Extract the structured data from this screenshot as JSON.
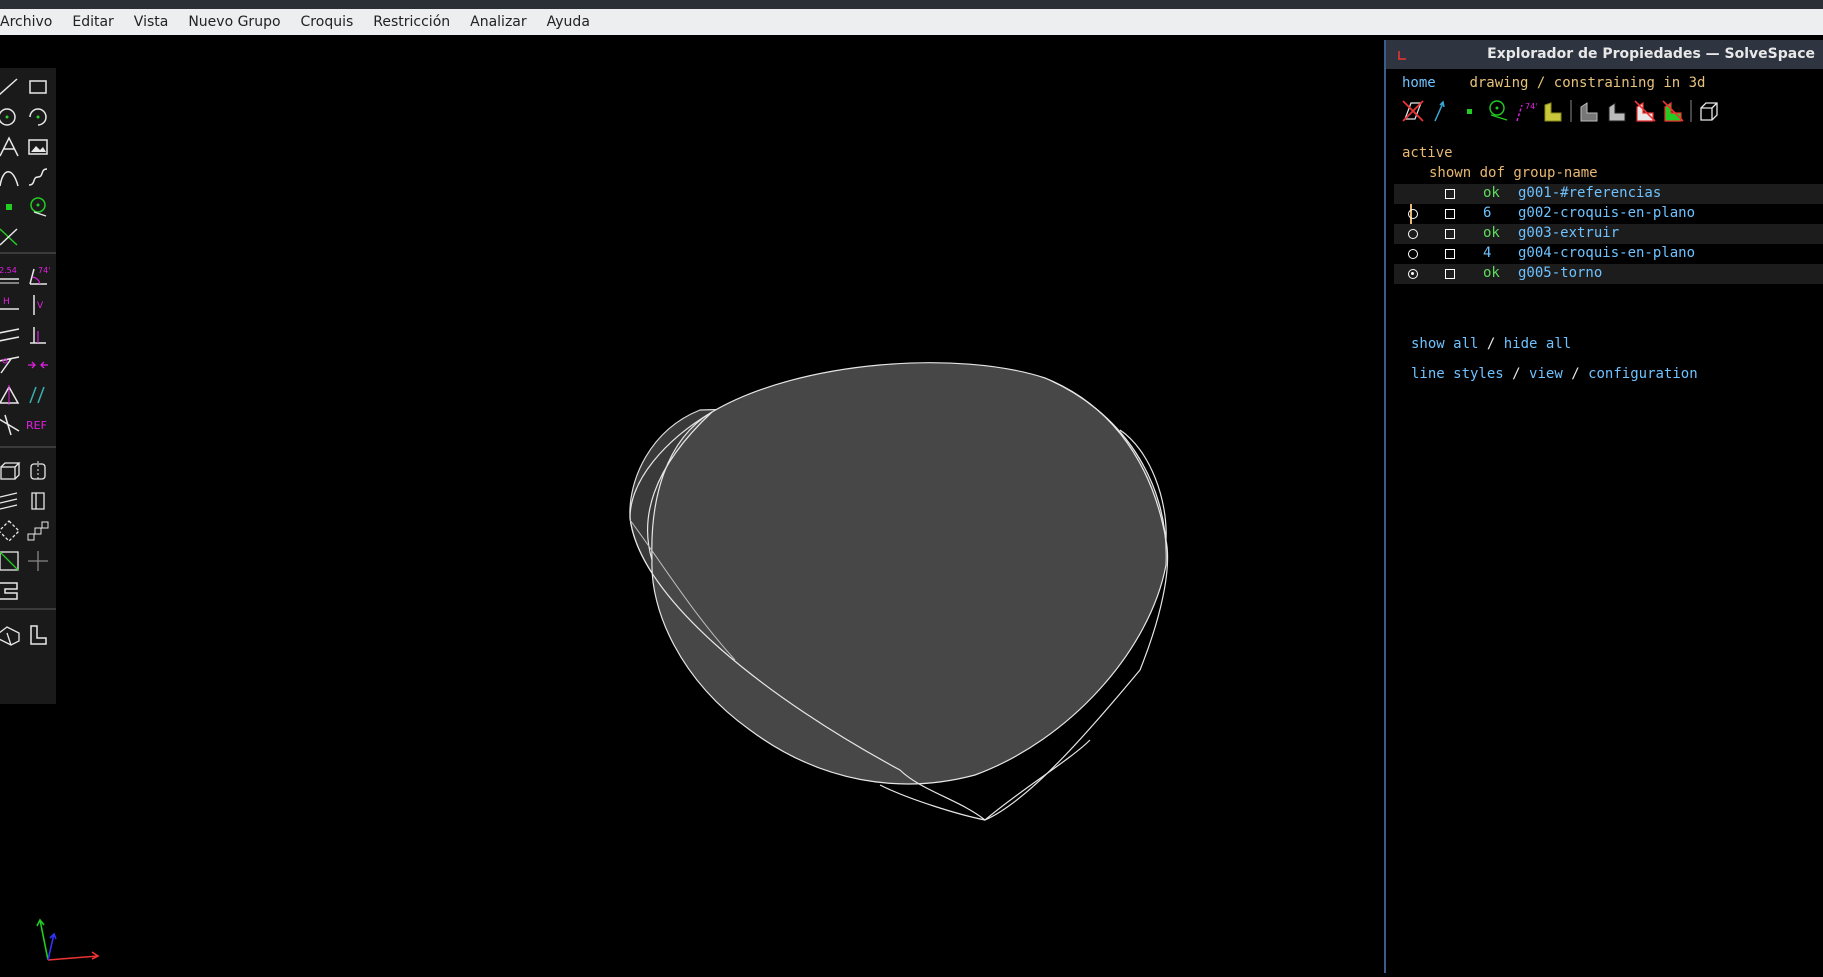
{
  "menubar": {
    "items": [
      "Archivo",
      "Editar",
      "Vista",
      "Nuevo Grupo",
      "Croquis",
      "Restricción",
      "Analizar",
      "Ayuda"
    ]
  },
  "toolbar": {
    "dimension_label": "2.54",
    "angle_label": "74°",
    "horizontal_label": "H",
    "vertical_label": "V",
    "ref_label": "REF"
  },
  "property_browser": {
    "title": "Explorador de Propiedades — SolveSpace",
    "nav": {
      "home": "home",
      "path1": "drawing",
      "sep": "/",
      "path2": "constraining in 3d"
    },
    "angle_icon_label": "74°",
    "active_label": "active",
    "columns": {
      "shown": "shown",
      "dof": "dof",
      "group_name": "group-name"
    },
    "groups": [
      {
        "dof": "ok",
        "name": "g001-#referencias",
        "radio": "none"
      },
      {
        "dof": "6",
        "name": "g002-croquis-en-plano",
        "radio": "empty"
      },
      {
        "dof": "ok",
        "name": "g003-extruir",
        "radio": "empty"
      },
      {
        "dof": "4",
        "name": "g004-croquis-en-plano",
        "radio": "empty"
      },
      {
        "dof": "ok",
        "name": "g005-torno",
        "radio": "selected"
      }
    ],
    "show_all": "show all",
    "slash": "/",
    "hide_all": "hide all",
    "line_styles": "line styles",
    "view": "view",
    "configuration": "configuration"
  },
  "colors": {
    "accent_cyan": "#6fc2ff",
    "ok_green": "#5fdc5f",
    "label_amber": "#e8b872",
    "magenta": "#e020e0"
  }
}
